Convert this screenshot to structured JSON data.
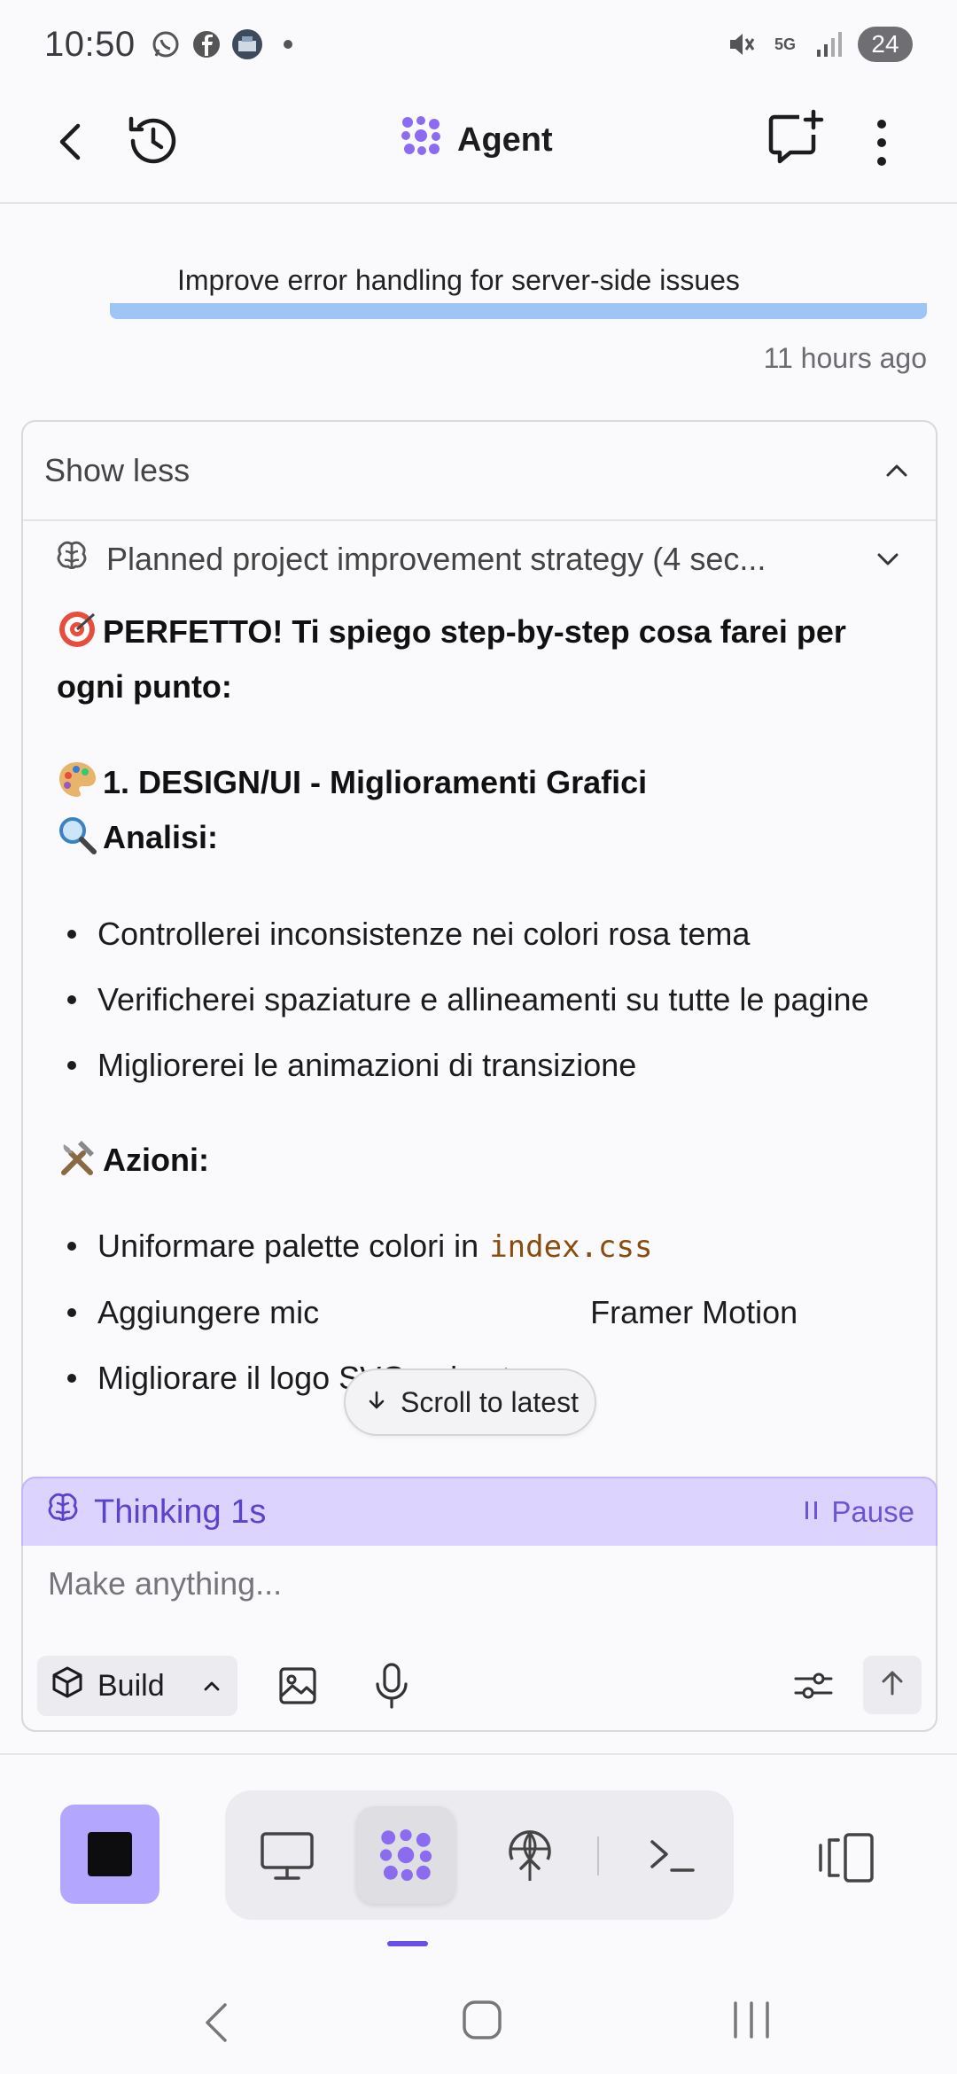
{
  "status_bar": {
    "time": "10:50",
    "battery": "24",
    "network": "5G",
    "icons": [
      "whatsapp-icon",
      "facebook-icon",
      "app-photo-icon",
      "dot-icon",
      "mute-icon",
      "data-arrows-icon",
      "signal-icon"
    ]
  },
  "header": {
    "title": "Agent",
    "icons": [
      "back-arrow-icon",
      "history-icon",
      "agent-logo-icon",
      "new-chat-icon",
      "more-vert-icon"
    ]
  },
  "task": {
    "text": "Improve error handling for server-side issues",
    "time": "11 hours ago",
    "accent_color": "#9ec5f3"
  },
  "card": {
    "show_less": "Show less",
    "plan_step": "Planned project improvement strategy (4 sec...",
    "heading": "PERFETTO! Ti spiego step-by-step cosa farei per ogni punto:",
    "section_title": "1. DESIGN/UI - Miglioramenti Grafici",
    "analysis_label": "Analisi:",
    "analysis_items": [
      "Controllerei inconsistenze nei colori rosa tema",
      "Verificherei spaziature e allineamenti su tutte le pagine",
      "Migliorerei le animazioni di transizione"
    ],
    "actions_label": "Azioni:",
    "action_item_1_prefix": "Uniformare palette colori in",
    "action_item_1_code": "index.css",
    "action_item_2_left": "Aggiungere mic",
    "action_item_2_right": "Framer Motion",
    "action_item_3": "Migliorare il logo SVG animato"
  },
  "scroll_latest": {
    "label": "Scroll to latest"
  },
  "thinking": {
    "label": "Thinking 1s",
    "pause": "Pause",
    "bg_color": "#dcd4ff",
    "text_color": "#5a44c9"
  },
  "composer": {
    "placeholder": "Make anything...",
    "mode": "Build"
  },
  "toolbar": {
    "stop_color": "#b3a6ff",
    "items": [
      "preview-icon",
      "agent-icon",
      "deploy-icon",
      "terminal-icon"
    ],
    "active": "agent-icon",
    "indicator_color": "#6b4ee6"
  }
}
